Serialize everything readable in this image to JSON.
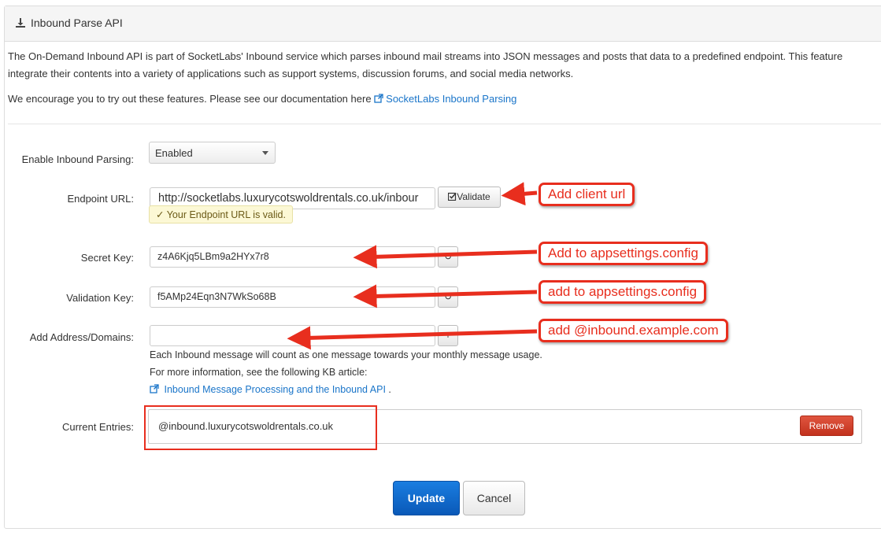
{
  "panel": {
    "title": "Inbound Parse API",
    "description_line1": "The On-Demand Inbound API is part of SocketLabs' Inbound service which parses inbound mail streams into JSON messages and posts that data to a predefined endpoint. This feature",
    "description_line2": "integrate their contents into a variety of applications such as support systems, discussion forums, and social media networks.",
    "encourage_text": "We encourage you to try out these features. Please see our documentation here ",
    "doc_link": "SocketLabs Inbound Parsing"
  },
  "form": {
    "enable_label": "Enable Inbound Parsing:",
    "enable_value": "Enabled",
    "endpoint_label": "Endpoint URL:",
    "endpoint_value": "http://socketlabs.luxurycotswoldrentals.co.uk/inbour",
    "validate_button": "Validate",
    "valid_message": "Your Endpoint URL is valid.",
    "secret_label": "Secret Key:",
    "secret_value": "z4A6Kjq5LBm9a2HYx7r8",
    "validation_label": "Validation Key:",
    "validation_value": "f5AMp24Eqn3N7WkSo68B",
    "address_label": "Add Address/Domains:",
    "address_value": "",
    "note_usage": "Each Inbound message will count as one message towards your monthly message usage.",
    "note_more": "For more information, see the following KB article:",
    "kb_link": "Inbound Message Processing and the Inbound API",
    "kb_suffix": " .",
    "entries_label": "Current Entries:",
    "entry_value": "@inbound.luxurycotswoldrentals.co.uk",
    "remove_button": "Remove",
    "update_button": "Update",
    "cancel_button": "Cancel"
  },
  "annotations": {
    "client_url": "Add client url",
    "secret": "Add to appsettings.config",
    "validation": "add to appsettings.config",
    "domain": "add @inbound.example.com"
  },
  "colors": {
    "annotation_red": "#e82e1e",
    "link_blue": "#1a75c9",
    "update_blue": "#0a59b8",
    "remove_red": "#c2321d"
  }
}
